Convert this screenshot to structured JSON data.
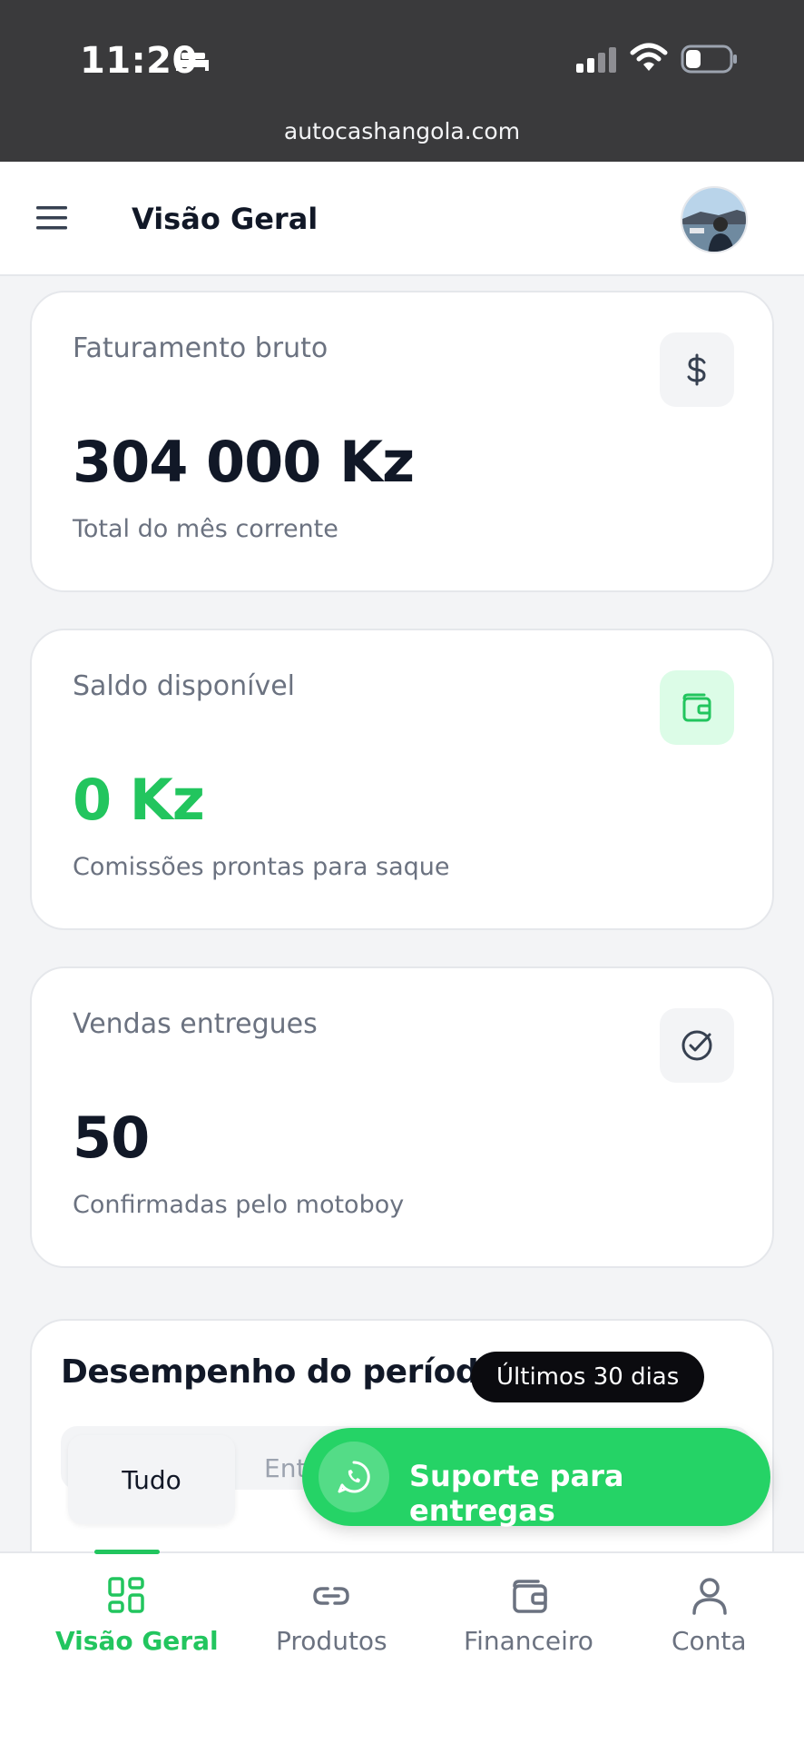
{
  "status_bar": {
    "time": "11:20",
    "url": "autocashangola.com"
  },
  "header": {
    "title": "Visão Geral"
  },
  "cards": [
    {
      "label": "Faturamento bruto",
      "value": "304 000 Kz",
      "sub": "Total do mês corrente",
      "icon": "dollar-icon"
    },
    {
      "label": "Saldo disponível",
      "value": "0 Kz",
      "sub": "Comissões prontas para saque",
      "icon": "wallet-icon",
      "accent": "#22c55e"
    },
    {
      "label": "Vendas entregues",
      "value": "50",
      "sub": "Confirmadas pelo motoboy",
      "icon": "check-circle-icon"
    }
  ],
  "performance": {
    "title": "Desempenho do período",
    "period": "Últimos 30 dias",
    "tabs": [
      {
        "label": "Tudo",
        "active": true
      },
      {
        "label": "Ent",
        "active": false
      }
    ]
  },
  "support": {
    "label": "Suporte para entregas",
    "icon": "whatsapp-icon",
    "color": "#25d366"
  },
  "bottom_nav": {
    "items": [
      {
        "label": "Visão Geral",
        "icon": "grid-icon",
        "active": true
      },
      {
        "label": "Produtos",
        "icon": "link-icon",
        "active": false
      },
      {
        "label": "Financeiro",
        "icon": "wallet-icon",
        "active": false
      },
      {
        "label": "Conta",
        "icon": "user-icon",
        "active": false
      }
    ],
    "active_color": "#22c55e"
  }
}
